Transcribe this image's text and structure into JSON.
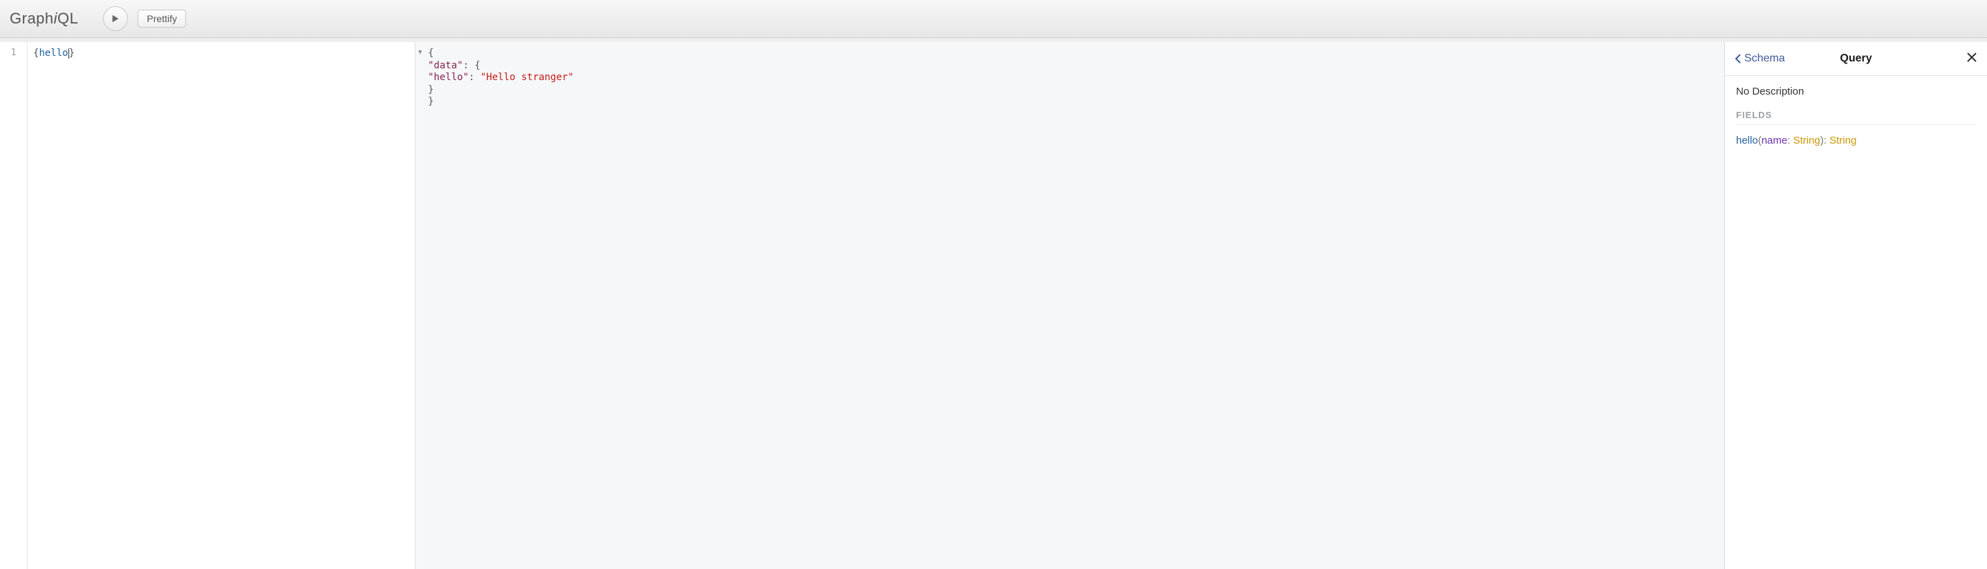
{
  "topbar": {
    "logo_pre": "Graph",
    "logo_i": "i",
    "logo_post": "QL",
    "prettify_label": "Prettify"
  },
  "editor": {
    "line_number": "1",
    "query_open": "{",
    "query_field": "hello",
    "query_close": "}"
  },
  "result": {
    "l1": "{",
    "l2_indent": "  ",
    "l2_key": "\"data\"",
    "l2_sep": ": {",
    "l3_indent": "    ",
    "l3_key": "\"hello\"",
    "l3_sep": ": ",
    "l3_val": "\"Hello stranger\"",
    "l4": "  }",
    "l5": "}"
  },
  "docs": {
    "back_label": "Schema",
    "title": "Query",
    "description": "No Description",
    "section_fields": "FIELDS",
    "field": {
      "name": "hello",
      "paren_open": "(",
      "arg_name": "name",
      "arg_colon": ": ",
      "arg_type": "String",
      "paren_close": ")",
      "ret_colon": ": ",
      "ret_type": "String"
    }
  }
}
